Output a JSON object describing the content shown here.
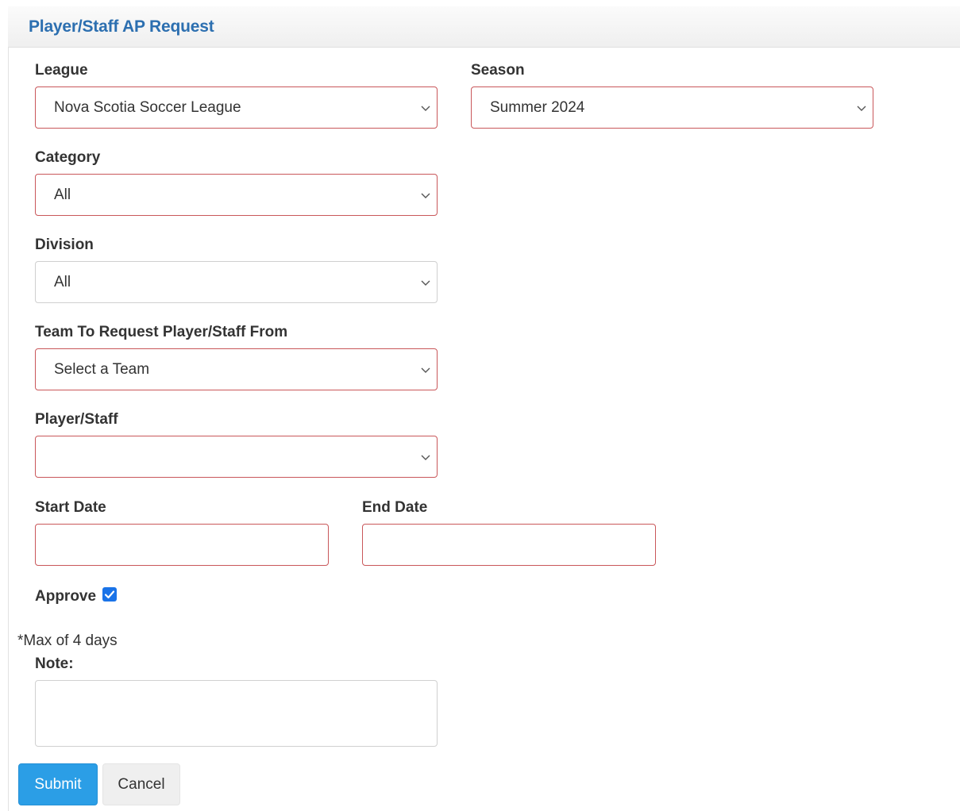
{
  "header": {
    "title": "Player/Staff AP Request"
  },
  "form": {
    "league": {
      "label": "League",
      "value": "Nova Scotia Soccer League"
    },
    "season": {
      "label": "Season",
      "value": "Summer 2024"
    },
    "category": {
      "label": "Category",
      "value": "All"
    },
    "division": {
      "label": "Division",
      "value": "All"
    },
    "team": {
      "label": "Team To Request Player/Staff From",
      "value": "Select a Team"
    },
    "player": {
      "label": "Player/Staff",
      "value": ""
    },
    "start_date": {
      "label": "Start Date",
      "value": ""
    },
    "end_date": {
      "label": "End Date",
      "value": ""
    },
    "approve": {
      "label": "Approve",
      "checked": true
    },
    "max_note": "*Max of 4 days",
    "note": {
      "label": "Note:",
      "value": ""
    }
  },
  "buttons": {
    "submit": "Submit",
    "cancel": "Cancel"
  },
  "colors": {
    "accent": "#2b9ee6",
    "title": "#2c6fb0",
    "error_border": "#c9575a"
  }
}
